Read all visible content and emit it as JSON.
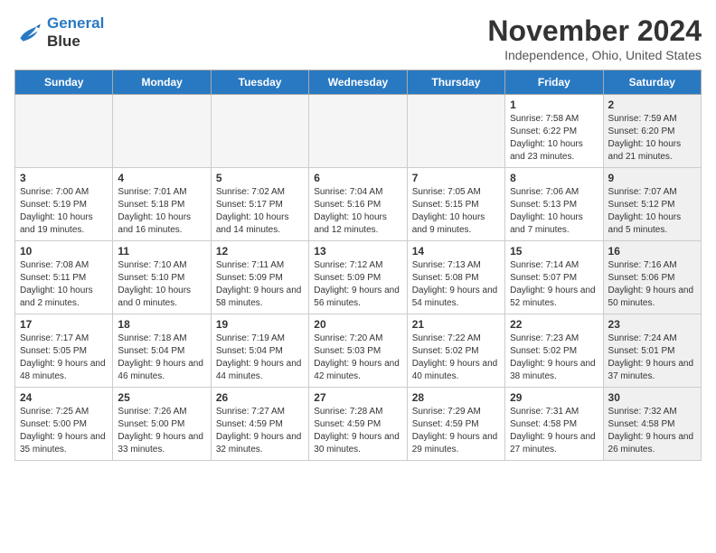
{
  "header": {
    "logo_line1": "General",
    "logo_line2": "Blue",
    "month_title": "November 2024",
    "location": "Independence, Ohio, United States"
  },
  "weekdays": [
    "Sunday",
    "Monday",
    "Tuesday",
    "Wednesday",
    "Thursday",
    "Friday",
    "Saturday"
  ],
  "weeks": [
    [
      {
        "day": "",
        "empty": true
      },
      {
        "day": "",
        "empty": true
      },
      {
        "day": "",
        "empty": true
      },
      {
        "day": "",
        "empty": true
      },
      {
        "day": "",
        "empty": true
      },
      {
        "day": "1",
        "info": "Sunrise: 7:58 AM\nSunset: 6:22 PM\nDaylight: 10 hours\nand 23 minutes.",
        "shaded": false
      },
      {
        "day": "2",
        "info": "Sunrise: 7:59 AM\nSunset: 6:20 PM\nDaylight: 10 hours\nand 21 minutes.",
        "shaded": true
      }
    ],
    [
      {
        "day": "3",
        "info": "Sunrise: 7:00 AM\nSunset: 5:19 PM\nDaylight: 10 hours\nand 19 minutes.",
        "shaded": false
      },
      {
        "day": "4",
        "info": "Sunrise: 7:01 AM\nSunset: 5:18 PM\nDaylight: 10 hours\nand 16 minutes.",
        "shaded": false
      },
      {
        "day": "5",
        "info": "Sunrise: 7:02 AM\nSunset: 5:17 PM\nDaylight: 10 hours\nand 14 minutes.",
        "shaded": false
      },
      {
        "day": "6",
        "info": "Sunrise: 7:04 AM\nSunset: 5:16 PM\nDaylight: 10 hours\nand 12 minutes.",
        "shaded": false
      },
      {
        "day": "7",
        "info": "Sunrise: 7:05 AM\nSunset: 5:15 PM\nDaylight: 10 hours\nand 9 minutes.",
        "shaded": false
      },
      {
        "day": "8",
        "info": "Sunrise: 7:06 AM\nSunset: 5:13 PM\nDaylight: 10 hours\nand 7 minutes.",
        "shaded": false
      },
      {
        "day": "9",
        "info": "Sunrise: 7:07 AM\nSunset: 5:12 PM\nDaylight: 10 hours\nand 5 minutes.",
        "shaded": true
      }
    ],
    [
      {
        "day": "10",
        "info": "Sunrise: 7:08 AM\nSunset: 5:11 PM\nDaylight: 10 hours\nand 2 minutes.",
        "shaded": false
      },
      {
        "day": "11",
        "info": "Sunrise: 7:10 AM\nSunset: 5:10 PM\nDaylight: 10 hours\nand 0 minutes.",
        "shaded": false
      },
      {
        "day": "12",
        "info": "Sunrise: 7:11 AM\nSunset: 5:09 PM\nDaylight: 9 hours\nand 58 minutes.",
        "shaded": false
      },
      {
        "day": "13",
        "info": "Sunrise: 7:12 AM\nSunset: 5:09 PM\nDaylight: 9 hours\nand 56 minutes.",
        "shaded": false
      },
      {
        "day": "14",
        "info": "Sunrise: 7:13 AM\nSunset: 5:08 PM\nDaylight: 9 hours\nand 54 minutes.",
        "shaded": false
      },
      {
        "day": "15",
        "info": "Sunrise: 7:14 AM\nSunset: 5:07 PM\nDaylight: 9 hours\nand 52 minutes.",
        "shaded": false
      },
      {
        "day": "16",
        "info": "Sunrise: 7:16 AM\nSunset: 5:06 PM\nDaylight: 9 hours\nand 50 minutes.",
        "shaded": true
      }
    ],
    [
      {
        "day": "17",
        "info": "Sunrise: 7:17 AM\nSunset: 5:05 PM\nDaylight: 9 hours\nand 48 minutes.",
        "shaded": false
      },
      {
        "day": "18",
        "info": "Sunrise: 7:18 AM\nSunset: 5:04 PM\nDaylight: 9 hours\nand 46 minutes.",
        "shaded": false
      },
      {
        "day": "19",
        "info": "Sunrise: 7:19 AM\nSunset: 5:04 PM\nDaylight: 9 hours\nand 44 minutes.",
        "shaded": false
      },
      {
        "day": "20",
        "info": "Sunrise: 7:20 AM\nSunset: 5:03 PM\nDaylight: 9 hours\nand 42 minutes.",
        "shaded": false
      },
      {
        "day": "21",
        "info": "Sunrise: 7:22 AM\nSunset: 5:02 PM\nDaylight: 9 hours\nand 40 minutes.",
        "shaded": false
      },
      {
        "day": "22",
        "info": "Sunrise: 7:23 AM\nSunset: 5:02 PM\nDaylight: 9 hours\nand 38 minutes.",
        "shaded": false
      },
      {
        "day": "23",
        "info": "Sunrise: 7:24 AM\nSunset: 5:01 PM\nDaylight: 9 hours\nand 37 minutes.",
        "shaded": true
      }
    ],
    [
      {
        "day": "24",
        "info": "Sunrise: 7:25 AM\nSunset: 5:00 PM\nDaylight: 9 hours\nand 35 minutes.",
        "shaded": false
      },
      {
        "day": "25",
        "info": "Sunrise: 7:26 AM\nSunset: 5:00 PM\nDaylight: 9 hours\nand 33 minutes.",
        "shaded": false
      },
      {
        "day": "26",
        "info": "Sunrise: 7:27 AM\nSunset: 4:59 PM\nDaylight: 9 hours\nand 32 minutes.",
        "shaded": false
      },
      {
        "day": "27",
        "info": "Sunrise: 7:28 AM\nSunset: 4:59 PM\nDaylight: 9 hours\nand 30 minutes.",
        "shaded": false
      },
      {
        "day": "28",
        "info": "Sunrise: 7:29 AM\nSunset: 4:59 PM\nDaylight: 9 hours\nand 29 minutes.",
        "shaded": false
      },
      {
        "day": "29",
        "info": "Sunrise: 7:31 AM\nSunset: 4:58 PM\nDaylight: 9 hours\nand 27 minutes.",
        "shaded": false
      },
      {
        "day": "30",
        "info": "Sunrise: 7:32 AM\nSunset: 4:58 PM\nDaylight: 9 hours\nand 26 minutes.",
        "shaded": true
      }
    ]
  ]
}
